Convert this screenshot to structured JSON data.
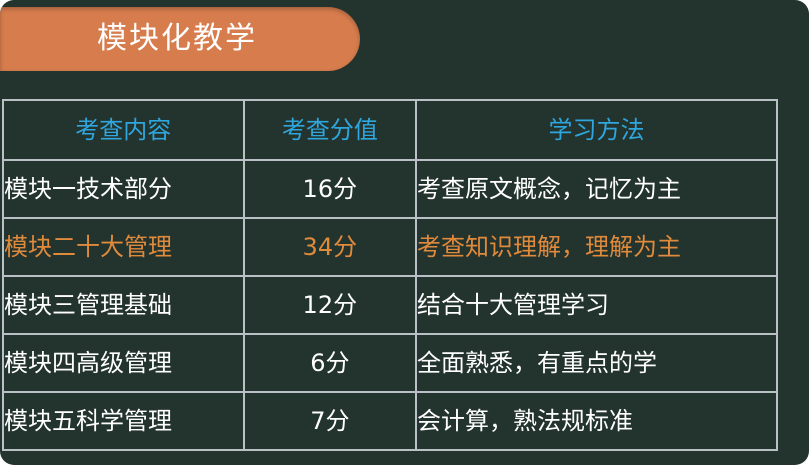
{
  "title": "模块化教学",
  "table": {
    "headers": [
      "考查内容",
      "考查分值",
      "学习方法"
    ],
    "rows": [
      {
        "module": "模块一技术部分",
        "score": "16分",
        "method": "考查原文概念，记忆为主"
      },
      {
        "module": "模块二十大管理",
        "score": "34分",
        "method": "考查知识理解，理解为主"
      },
      {
        "module": "模块三管理基础",
        "score": "12分",
        "method": "结合十大管理学习"
      },
      {
        "module": "模块四高级管理",
        "score": "6分",
        "method": "全面熟悉，有重点的学"
      },
      {
        "module": "模块五科学管理",
        "score": "7分",
        "method": "会计算，熟法规标准"
      }
    ]
  },
  "colors": {
    "background": "#23332d",
    "title_pill": "#d67c4d",
    "header_text": "#2fa6de",
    "highlight_text": "#e08a3c",
    "body_text": "#ffffff",
    "grid_lines": "#b9c1c6"
  }
}
